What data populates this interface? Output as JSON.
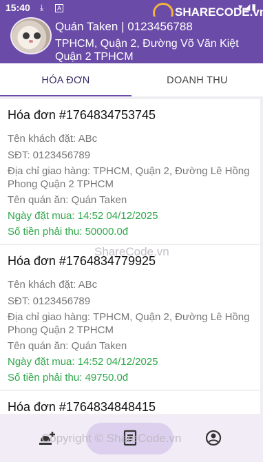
{
  "status_bar": {
    "time": "15:40",
    "icons": [
      "download-icon",
      "a-icon"
    ],
    "right_icons": [
      "wifi-icon",
      "signal-icon",
      "battery-icon"
    ]
  },
  "watermark": {
    "logo_text": "SHARECODE.vn",
    "middle": "ShareCode.vn",
    "footer": "Copyright © ShareCode.vn"
  },
  "header": {
    "shop_line": "Quán Taken | 0123456788",
    "address": "TPHCM, Quận 2, Đường Võ Văn Kiệt Quận 2 TPHCM"
  },
  "tabs": [
    {
      "label": "HÓA ĐƠN",
      "active": true
    },
    {
      "label": "DOANH THU",
      "active": false
    }
  ],
  "orders": [
    {
      "title": "Hóa đơn #1764834753745",
      "customer": "Tên khách đặt: ABc",
      "phone": "SĐT: 0123456789",
      "address": "Địa chỉ giao hàng: TPHCM, Quận 2, Đường Lê Hồng Phong Quận 2 TPHCM",
      "restaurant": "Tên quán ăn: Quán Taken",
      "date": "Ngày đặt mua: 14:52 04/12/2025",
      "amount": "Số tiền phải thu: 50000.0đ"
    },
    {
      "title": "Hóa đơn #1764834779925",
      "customer": "Tên khách đặt: ABc",
      "phone": "SĐT: 0123456789",
      "address": "Địa chỉ giao hàng: TPHCM, Quận 2, Đường Lê Hồng Phong Quận 2 TPHCM",
      "restaurant": "Tên quán ăn: Quán Taken",
      "date": "Ngày đặt mua: 14:52 04/12/2025",
      "amount": "Số tiền phải thu: 49750.0đ"
    },
    {
      "title": "Hóa đơn #1764834848415"
    }
  ],
  "colors": {
    "primary": "#6b4ba8",
    "green": "#2ea84a"
  },
  "bottom_nav": [
    "add-food-icon",
    "receipt-icon",
    "profile-icon"
  ]
}
